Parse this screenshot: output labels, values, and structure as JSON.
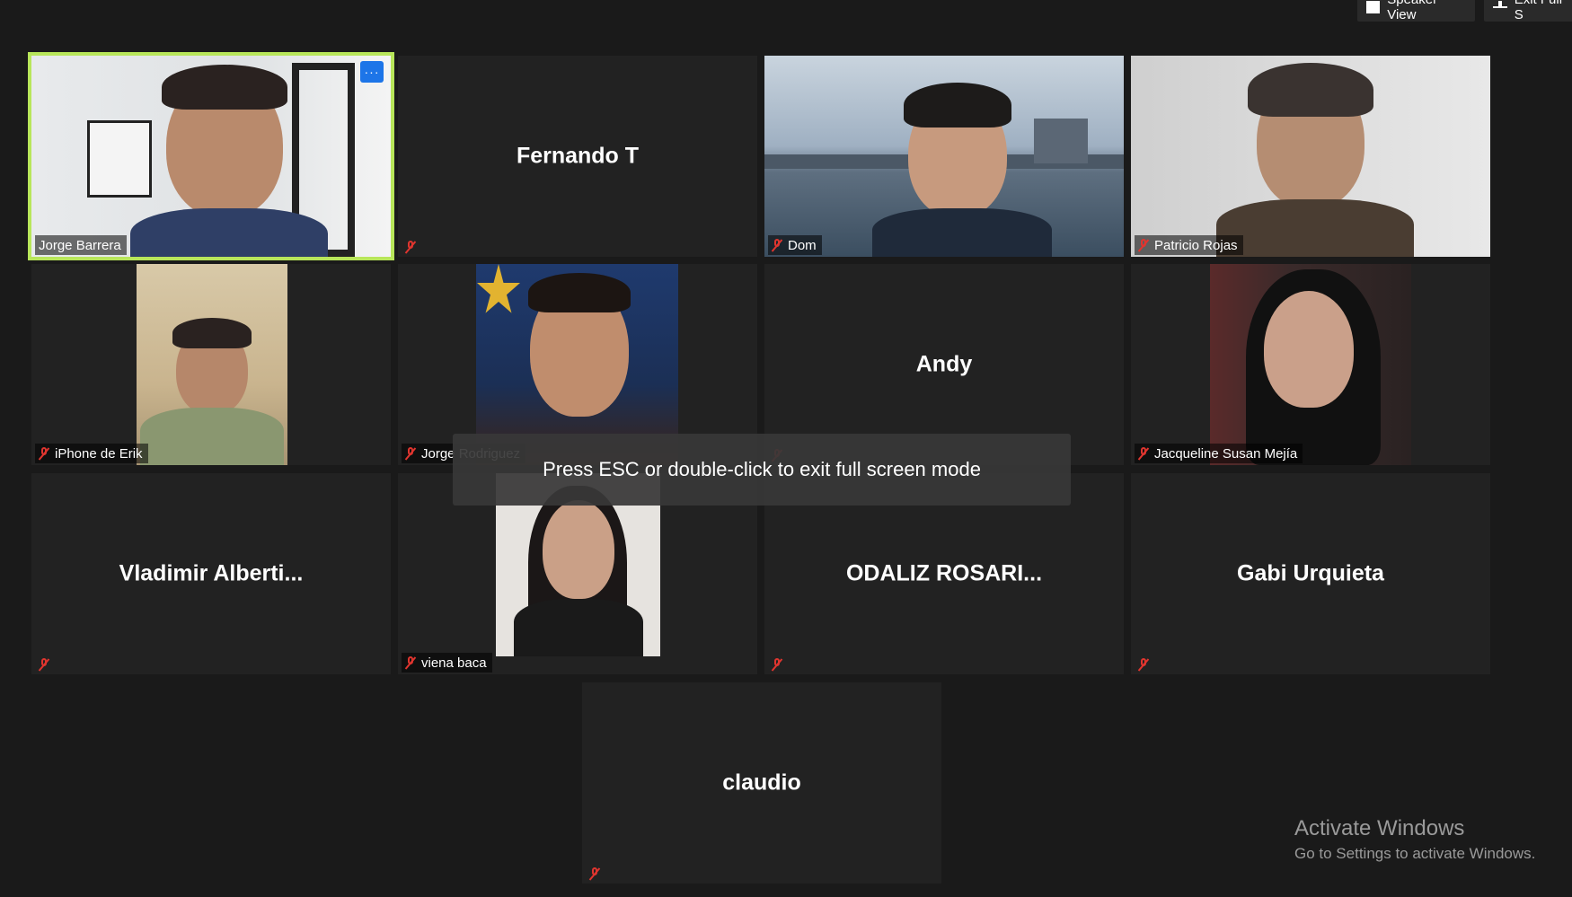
{
  "controls": {
    "speaker_view": "Speaker View",
    "exit_full_screen": "Exit Full S"
  },
  "participants": [
    {
      "name": "Jorge Barrera",
      "video": true,
      "muted": false,
      "active": true
    },
    {
      "name": "Fernando T",
      "video": false,
      "muted": true,
      "show_label": false
    },
    {
      "name": "Dom",
      "video": true,
      "muted": true
    },
    {
      "name": "Patricio Rojas",
      "video": true,
      "muted": true
    },
    {
      "name": "iPhone de Erik",
      "video": true,
      "muted": true
    },
    {
      "name": "Jorge Rodriguez",
      "video": true,
      "muted": true
    },
    {
      "name": "Andy",
      "video": false,
      "muted": true,
      "show_label": false
    },
    {
      "name": "Jacqueline Susan Mejía",
      "video": true,
      "muted": true
    },
    {
      "name": "Vladimir  Alberti...",
      "video": false,
      "muted": true,
      "show_label": false
    },
    {
      "name": "viena baca",
      "video": true,
      "muted": true
    },
    {
      "name": "ODALIZ  ROSARI...",
      "video": false,
      "muted": true,
      "show_label": false
    },
    {
      "name": "Gabi Urquieta",
      "video": false,
      "muted": true,
      "show_label": false
    },
    {
      "name": "claudio",
      "video": false,
      "muted": true,
      "show_label": false
    }
  ],
  "more_button": "···",
  "toast": "Press ESC or double-click to exit full screen mode",
  "watermark": {
    "title": "Activate Windows",
    "subtitle": "Go to Settings to activate Windows."
  }
}
